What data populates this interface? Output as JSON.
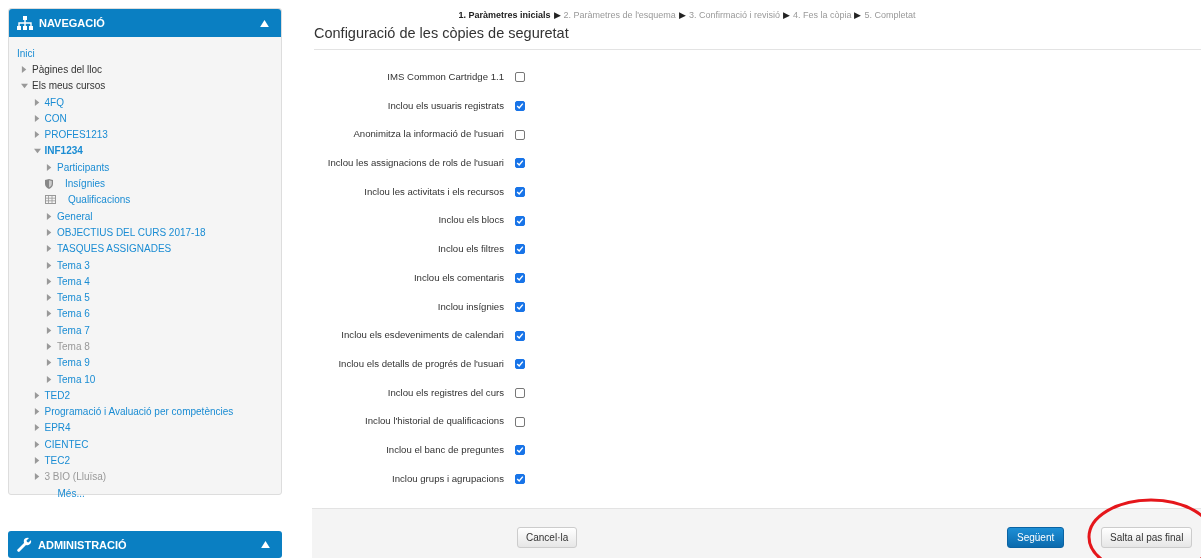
{
  "navigation": {
    "title": "NAVEGACIÓ",
    "expanded": true,
    "items": [
      {
        "label": "Inici",
        "kind": "leaf"
      },
      {
        "label": "Pàgines del lloc",
        "kind": "plain",
        "expanded": false
      },
      {
        "label": "Els meus cursos",
        "kind": "plain",
        "expanded": true,
        "children": [
          {
            "label": "4FQ",
            "kind": "link",
            "expanded": false
          },
          {
            "label": "CON",
            "kind": "link",
            "expanded": false
          },
          {
            "label": "PROFES1213",
            "kind": "link",
            "expanded": false
          },
          {
            "label": "INF1234",
            "kind": "link",
            "expanded": true,
            "current": true,
            "children": [
              {
                "label": "Participants",
                "kind": "link",
                "expanded": false
              },
              {
                "label": "Insígnies",
                "kind": "badges"
              },
              {
                "label": "Qualificacions",
                "kind": "grades"
              },
              {
                "label": "General",
                "kind": "link",
                "expanded": false
              },
              {
                "label": "OBJECTIUS DEL CURS 2017-18",
                "kind": "link",
                "expanded": false
              },
              {
                "label": "TASQUES ASSIGNADES",
                "kind": "link",
                "expanded": false
              },
              {
                "label": "Tema 3",
                "kind": "link",
                "expanded": false
              },
              {
                "label": "Tema 4",
                "kind": "link",
                "expanded": false
              },
              {
                "label": "Tema 5",
                "kind": "link",
                "expanded": false
              },
              {
                "label": "Tema 6",
                "kind": "link",
                "expanded": false
              },
              {
                "label": "Tema 7",
                "kind": "link",
                "expanded": false
              },
              {
                "label": "Tema 8",
                "kind": "hidden",
                "expanded": false
              },
              {
                "label": "Tema 9",
                "kind": "link",
                "expanded": false
              },
              {
                "label": "Tema 10",
                "kind": "link",
                "expanded": false
              }
            ]
          },
          {
            "label": "TED2",
            "kind": "link",
            "expanded": false
          },
          {
            "label": "Programació i Avaluació per competències",
            "kind": "link",
            "expanded": false
          },
          {
            "label": "EPR4",
            "kind": "link",
            "expanded": false
          },
          {
            "label": "CIENTEC",
            "kind": "link",
            "expanded": false
          },
          {
            "label": "TEC2",
            "kind": "link",
            "expanded": false
          },
          {
            "label": "3 BIO (Lluïsa)",
            "kind": "hidden",
            "expanded": false
          },
          {
            "label": "Més...",
            "kind": "more"
          }
        ]
      }
    ]
  },
  "administration": {
    "title": "ADMINISTRACIÓ",
    "expanded": true
  },
  "steps": [
    {
      "label": "1. Paràmetres inicials",
      "selected": true
    },
    {
      "label": "2. Paràmetres de l'esquema",
      "selected": false
    },
    {
      "label": "3. Confirmació i revisió",
      "selected": false
    },
    {
      "label": "4. Fes la còpia",
      "selected": false
    },
    {
      "label": "5. Completat",
      "selected": false
    }
  ],
  "step_separator": "▶",
  "title": "Configuració de les còpies de seguretat",
  "settings": [
    {
      "label": "IMS Common Cartridge 1.1",
      "checked": false
    },
    {
      "label": "Inclou els usuaris registrats",
      "checked": true
    },
    {
      "label": "Anonimitza la informació de l'usuari",
      "checked": false
    },
    {
      "label": "Inclou les assignacions de rols de l'usuari",
      "checked": true
    },
    {
      "label": "Inclou les activitats i els recursos",
      "checked": true
    },
    {
      "label": "Inclou els blocs",
      "checked": true
    },
    {
      "label": "Inclou els filtres",
      "checked": true
    },
    {
      "label": "Inclou els comentaris",
      "checked": true
    },
    {
      "label": "Inclou insígnies",
      "checked": true
    },
    {
      "label": "Inclou els esdeveniments de calendari",
      "checked": true
    },
    {
      "label": "Inclou els detalls de progrés de l'usuari",
      "checked": true
    },
    {
      "label": "Inclou els registres del curs",
      "checked": false
    },
    {
      "label": "Inclou l'historial de qualificacions",
      "checked": false
    },
    {
      "label": "Inclou el banc de preguntes",
      "checked": true
    },
    {
      "label": "Inclou grups i agrupacions",
      "checked": true
    }
  ],
  "buttons": [
    {
      "label": "Cancel·la",
      "kind": "default",
      "highlighted": false
    },
    {
      "label": "Següent",
      "kind": "primary",
      "highlighted": false
    },
    {
      "label": "Salta al pas final",
      "kind": "default",
      "highlighted": true
    }
  ]
}
